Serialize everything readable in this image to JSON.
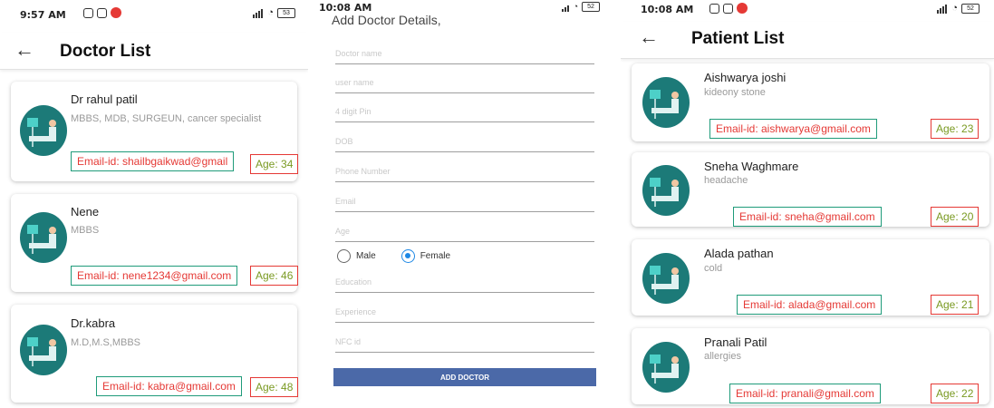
{
  "doctor_screen": {
    "status": {
      "time": "9:57 AM",
      "battery": "53"
    },
    "title": "Doctor List",
    "doctors": [
      {
        "name": "Dr rahul patil",
        "qualification": "MBBS, MDB, SURGEUN, cancer specialist",
        "email": "Email-id: shailbgaikwad@gmail",
        "age": "Age: 34"
      },
      {
        "name": "Nene",
        "qualification": "MBBS",
        "email": "Email-id: nene1234@gmail.com",
        "age": "Age: 46"
      },
      {
        "name": "Dr.kabra",
        "qualification": "M.D,M.S,MBBS",
        "email": "Email-id: kabra@gmail.com",
        "age": "Age: 48"
      }
    ]
  },
  "add_screen": {
    "status": {
      "time": "10:08 AM",
      "battery": "52"
    },
    "title": "Add Doctor Details,",
    "placeholders": {
      "doctor_name": "Doctor name",
      "user_name": "user name",
      "pin": "4 digit Pin",
      "dob": "DOB",
      "phone": "Phone Number",
      "email": "Email",
      "age": "Age",
      "education": "Education",
      "experience": "Experience",
      "nfc": "NFC id"
    },
    "gender": {
      "male": "Male",
      "female": "Female",
      "selected": "Female"
    },
    "button": "ADD DOCTOR"
  },
  "patient_screen": {
    "status": {
      "time": "10:08 AM",
      "battery": "52"
    },
    "title": "Patient List",
    "patients": [
      {
        "name": "Aishwarya joshi",
        "condition": "kideony stone",
        "email": "Email-id: aishwarya@gmail.com",
        "age": "Age: 23"
      },
      {
        "name": "Sneha Waghmare",
        "condition": "headache",
        "email": "Email-id: sneha@gmail.com",
        "age": "Age: 20"
      },
      {
        "name": "Alada pathan",
        "condition": "cold",
        "email": "Email-id: alada@gmail.com",
        "age": "Age: 21"
      },
      {
        "name": "Pranali Patil",
        "condition": "allergies",
        "email": "Email-id: pranali@gmail.com",
        "age": "Age: 22"
      }
    ]
  },
  "colors": {
    "accent": "#1e88e5",
    "email_text": "#e53935",
    "email_border": "#1f9b7a",
    "age_text": "#7a9a22",
    "button": "#4b69a8",
    "avatar": "#1c7a78"
  }
}
